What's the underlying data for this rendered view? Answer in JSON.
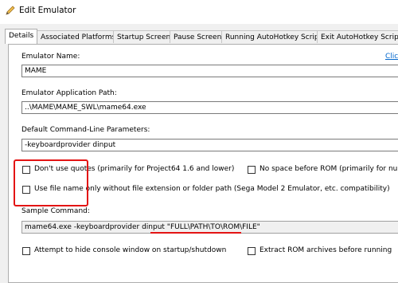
{
  "window": {
    "title": "Edit Emulator",
    "icon": "pencil-icon"
  },
  "tabs": [
    {
      "label": "Details",
      "active": true
    },
    {
      "label": "Associated Platforms"
    },
    {
      "label": "Startup Screen"
    },
    {
      "label": "Pause Screen"
    },
    {
      "label": "Running AutoHotkey Script"
    },
    {
      "label": "Exit AutoHotkey Script"
    }
  ],
  "form": {
    "emulator_name": {
      "label": "Emulator Name:",
      "value": "MAME",
      "link_text": "Click"
    },
    "app_path": {
      "label": "Emulator Application Path:",
      "value": "..\\MAME\\MAME_SWL\\mame64.exe"
    },
    "cmd_params": {
      "label": "Default Command-Line Parameters:",
      "value": "-keyboardprovider dinput"
    },
    "checkboxes": {
      "dont_use_quotes": {
        "label": "Don't use quotes (primarily for Project64 1.6 and lower)",
        "checked": false
      },
      "no_space_before_rom": {
        "label": "No space before ROM (primarily for nullDC)",
        "checked": false
      },
      "use_file_name_only": {
        "label": "Use file name only without file extension or folder path (Sega Model 2 Emulator, etc. compatibility)",
        "checked": false
      },
      "hide_console": {
        "label": "Attempt to hide console window on startup/shutdown",
        "checked": false
      },
      "extract_rom": {
        "label": "Extract ROM archives before running",
        "checked": false
      }
    },
    "sample_command": {
      "label": "Sample Command:",
      "value": "mame64.exe -keyboardprovider dinput \"FULL\\PATH\\TO\\ROM\\FILE\""
    }
  },
  "colors": {
    "highlight": "#e31414",
    "link": "#0066cc"
  }
}
